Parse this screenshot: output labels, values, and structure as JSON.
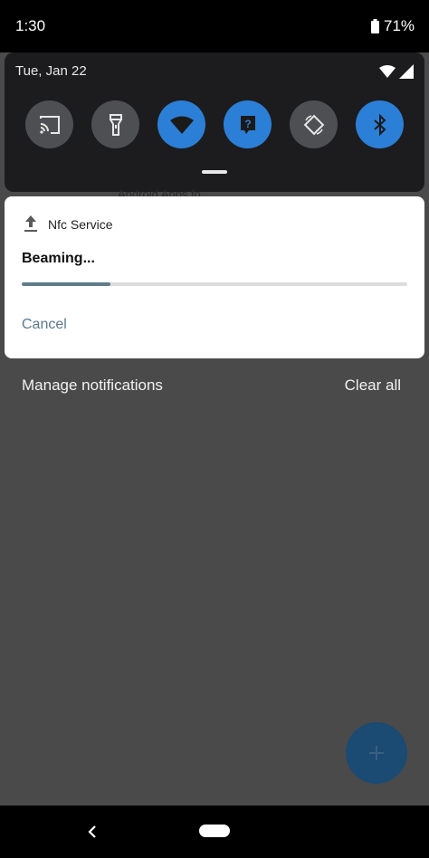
{
  "status_bar": {
    "time": "1:30",
    "battery": "71%"
  },
  "quick_settings": {
    "date": "Tue, Jan 22",
    "tiles": [
      {
        "name": "cast-icon",
        "state": "off"
      },
      {
        "name": "flashlight-icon",
        "state": "off"
      },
      {
        "name": "wifi-icon",
        "state": "on"
      },
      {
        "name": "unknown-data-icon",
        "state": "on"
      },
      {
        "name": "auto-rotate-icon",
        "state": "off"
      },
      {
        "name": "bluetooth-icon",
        "state": "on"
      }
    ]
  },
  "background_text": "Android Apps fo",
  "notification": {
    "app_name": "Nfc Service",
    "title": "Beaming...",
    "progress": 0.23,
    "action_label": "Cancel"
  },
  "footer": {
    "manage_label": "Manage notifications",
    "clear_label": "Clear all"
  },
  "colors": {
    "accent": "#2c7fd6",
    "tile_off": "#4e4f52",
    "panel": "#1c1c1e",
    "progress": "#5f7b8c"
  }
}
